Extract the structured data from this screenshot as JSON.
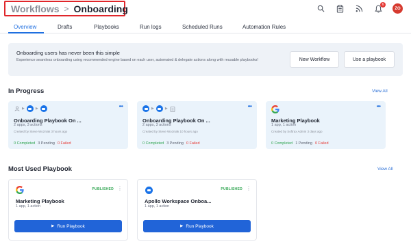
{
  "header": {
    "breadcrumb_root": "Workflows",
    "breadcrumb_separator": ">",
    "breadcrumb_current": "Onboarding",
    "icons": [
      "search-icon",
      "clipboard-icon",
      "rss-icon",
      "bell-icon"
    ],
    "notification_count": "6",
    "avatar_initials": "ZO"
  },
  "tabs": [
    {
      "label": "Overview",
      "active": true
    },
    {
      "label": "Drafts"
    },
    {
      "label": "Playbooks"
    },
    {
      "label": "Run logs"
    },
    {
      "label": "Scheduled Runs"
    },
    {
      "label": "Automation Rules"
    }
  ],
  "banner": {
    "title": "Onboarding users has never been this simple",
    "description": "Experience seamless onboarding using recommended engine based on each user, automated & delegate actions along with reusable playbooks!",
    "new_workflow_label": "New Workflow",
    "use_playbook_label": "Use a playbook"
  },
  "in_progress": {
    "title": "In Progress",
    "view_all": "View All",
    "more_glyph": "•••",
    "cards": [
      {
        "name": "Onboarding Playbook On ...",
        "meta": "2 apps, 3 actions",
        "created": "Created by Steve Wozniak 3 hours ago",
        "completed": "0 Completed",
        "pending": "3 Pending",
        "failed": "0 Failed",
        "icon": "zoom-icon"
      },
      {
        "name": "Onboarding Playbook On ...",
        "meta": "2 apps, 3 actions",
        "created": "Created by Steve Wozniak 10 hours ago",
        "completed": "0 Completed",
        "pending": "3 Pending",
        "failed": "0 Failed",
        "icon": "zoom-icon"
      },
      {
        "name": "Marketing Playbook",
        "meta": "1 app, 1 action",
        "created": "Created by Softrax Admin 3 days ago",
        "completed": "0 Completed",
        "pending": "1 Pending",
        "failed": "0 Failed",
        "icon": "google-icon"
      }
    ]
  },
  "most_used": {
    "title": "Most Used Playbook",
    "view_all": "View All",
    "cards": [
      {
        "name": "Marketing Playbook",
        "meta": "1 app, 1 action",
        "badge": "PUBLISHED",
        "run_label": "Run Playbook",
        "icon": "google-icon"
      },
      {
        "name": "Apollo Workspace Onboa...",
        "meta": "1 app, 1 action",
        "badge": "PUBLISHED",
        "run_label": "Run Playbook",
        "icon": "zoom-icon"
      }
    ]
  },
  "colors": {
    "accent": "#1f6fe0",
    "button_blue": "#2164d8",
    "highlight_border": "#e0262b",
    "card_bg": "#eaf3fb",
    "banner_bg": "#eef2f7",
    "success": "#2ea44f",
    "danger": "#e53935"
  }
}
